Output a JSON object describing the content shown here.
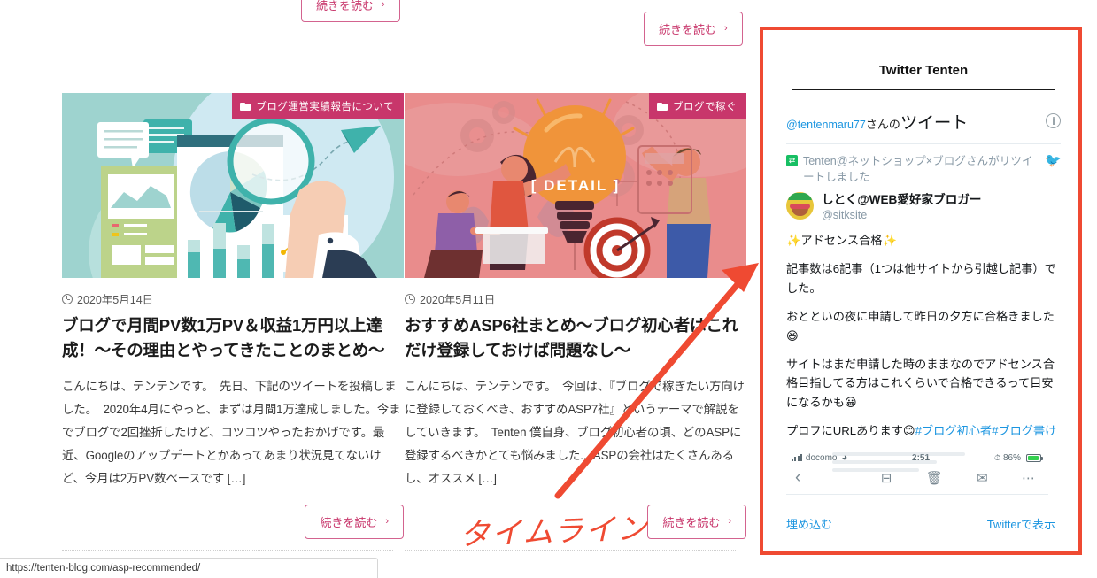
{
  "page": {
    "status_url": "https://tenten-blog.com/asp-recommended/"
  },
  "articles": {
    "top_partial_buttons": [
      {
        "label": "続きを読む",
        "chevron": "›"
      },
      {
        "label": "続きを読む",
        "chevron": "›"
      }
    ],
    "cards": [
      {
        "category": "ブログ運営実績報告について",
        "category_icon": "folder-icon",
        "date": "2020年5月14日",
        "date_icon": "clock-icon",
        "title": "ブログで月間PV数1万PV＆収益1万円以上達成！〜その理由とやってきたことのまとめ〜",
        "excerpt": "こんにちは、テンテンです。　先日、下記のツイートを投稿しました。　2020年4月にやっと、まずは月間1万達成しました。今までブログで2回挫折したけど、コツコツやったおかげです。最近、Googleのアップデートとかあってあまり状況見てないけど、今月は2万PV数ペースです […]",
        "readmore": "続きを読む",
        "chevron": "›",
        "image_alt": "analytics-illustration"
      },
      {
        "category": "ブログで稼ぐ",
        "category_icon": "folder-icon",
        "date": "2020年5月11日",
        "date_icon": "clock-icon",
        "title": "おすすめASP6社まとめ〜ブログ初心者はこれだけ登録しておけば問題なし〜",
        "excerpt": "こんにちは、テンテンです。　今回は、『ブログで稼ぎたい方向けに登録しておくべき、おすすめASP7社』というテーマで解説をしていきます。　Tenten 僕自身、ブログ初心者の頃、どのASPに登録するべきかとても悩みました... ASPの会社はたくさんあるし、オススメ […]",
        "readmore": "続きを読む",
        "chevron": "›",
        "image_alt": "idea-lightbulb-illustration",
        "image_overlay_text": "[ DETAIL ]"
      }
    ]
  },
  "sidebar": {
    "frame_color": "#ef4a32",
    "widget_title": "Twitter Tenten",
    "timeline": {
      "header_handle": "@tentenmaru77",
      "header_suffix": "さんの",
      "header_big": "ツイート",
      "info_icon": "info-icon",
      "retweet_icon": "retweet-icon",
      "retweet_text": "Tenten@ネットショップ×ブログさんがリツイートしました",
      "bird_icon": "twitter-bird-icon",
      "author_name": "しとく@WEB愛好家ブロガー",
      "author_handle": "@sitksite",
      "paragraphs": [
        "✨アドセンス合格✨",
        "記事数は6記事（1つは他サイトから引越し記事）でした。",
        "おとといの夜に申請して昨日の夕方に合格きました😆",
        "サイトはまだ申請した時のままなのでアドセンス合格目指してる方はこれくらいで合格できるって目安になるかも😀"
      ],
      "last_line_prefix": "プロフにURLあります😊",
      "hashtags": "#ブログ初心者#ブログ書け",
      "screenshot": {
        "carrier": "docomo",
        "wifi_icon": "wifi-icon",
        "signal_icon": "signal-bars-icon",
        "time": "2:51",
        "battery_percent": "86%",
        "battery_icon": "battery-charging-icon",
        "back_icon": "chevron-left-icon",
        "archive_icon": "archive-box-icon",
        "trash_icon": "trash-icon",
        "mail_icon": "envelope-icon",
        "more_icon": "ellipsis-icon"
      },
      "footer_left": "埋め込む",
      "footer_right": "Twitterで表示"
    }
  },
  "annotation": {
    "label": "タイムライン",
    "color": "#ef4a32",
    "arrow_icon": "arrow-up-right-icon"
  }
}
